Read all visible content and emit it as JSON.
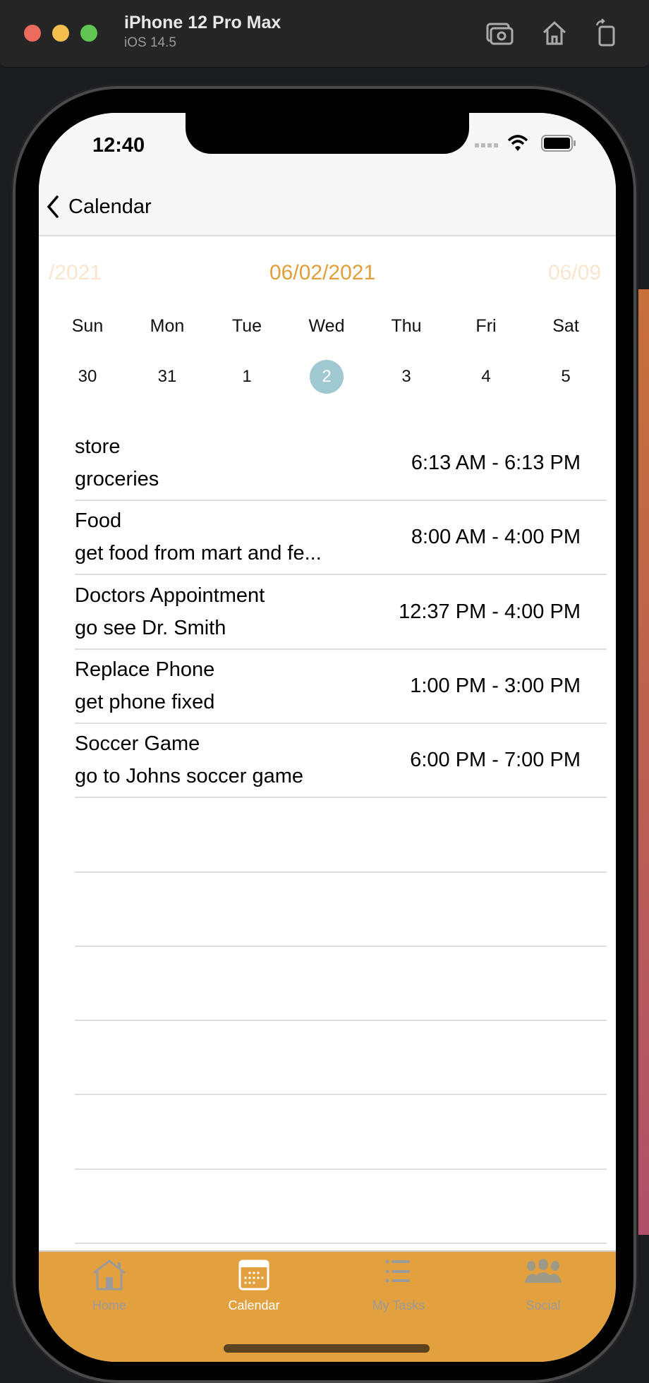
{
  "simulator": {
    "device": "iPhone 12 Pro Max",
    "os": "iOS 14.5"
  },
  "status_bar": {
    "time": "12:40"
  },
  "nav": {
    "back_label": "Calendar"
  },
  "date_header": {
    "prev": "/2021",
    "current": "06/02/2021",
    "next": "06/09"
  },
  "week": {
    "days": [
      "Sun",
      "Mon",
      "Tue",
      "Wed",
      "Thu",
      "Fri",
      "Sat"
    ],
    "dates": [
      "30",
      "31",
      "1",
      "2",
      "3",
      "4",
      "5"
    ],
    "selected_index": 3
  },
  "events": [
    {
      "title": "store",
      "subtitle": "groceries",
      "time": "6:13 AM - 6:13 PM"
    },
    {
      "title": "Food",
      "subtitle": "get food from mart and fe...",
      "time": "8:00 AM - 4:00 PM"
    },
    {
      "title": "Doctors Appointment",
      "subtitle": "go see Dr. Smith",
      "time": "12:37 PM - 4:00 PM"
    },
    {
      "title": "Replace Phone",
      "subtitle": "get phone fixed",
      "time": "1:00 PM - 3:00 PM"
    },
    {
      "title": "Soccer Game",
      "subtitle": "go to Johns soccer game",
      "time": "6:00 PM - 7:00 PM"
    }
  ],
  "tabs": [
    {
      "label": "Home",
      "icon": "house-icon"
    },
    {
      "label": "Calendar",
      "icon": "calendar-icon",
      "active": true
    },
    {
      "label": "My Tasks",
      "icon": "list-icon"
    },
    {
      "label": "Social",
      "icon": "people-icon"
    }
  ],
  "colors": {
    "accent": "#e2a03f",
    "selected_day": "#9fc8d0",
    "tab_inactive": "#9a9a9a"
  }
}
